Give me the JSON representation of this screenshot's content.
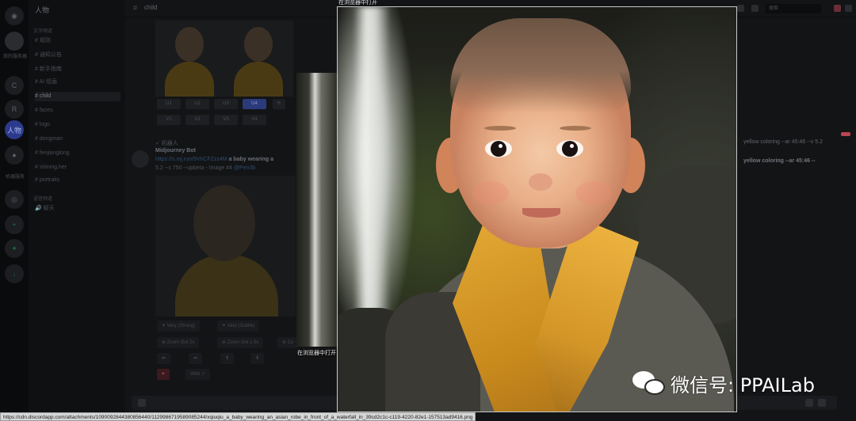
{
  "sidebar": {
    "header": "人物",
    "categories": [
      "文字频道",
      "语音频道"
    ],
    "channels": [
      "规则",
      "通知公告",
      "新手指南",
      "AI 绘画",
      "child",
      "faces",
      "logo",
      "dongman",
      "fenjianglong",
      "shining.her",
      "portraits"
    ],
    "voice": [
      "聊天"
    ],
    "server_labels": [
      "我的服务器",
      "人物",
      "机器服务"
    ]
  },
  "topbar": {
    "channel": "child",
    "search_placeholder": "搜索"
  },
  "grid_buttons": [
    "U1",
    "U2",
    "U3",
    "U4",
    "V1",
    "V2",
    "V3",
    "V4"
  ],
  "message": {
    "author": "Midjourney Bot",
    "badge": "✓ 机器人",
    "link": "https://s.mj.run/9VhCFZzz4M",
    "prompt": "a baby wearing an asian robe in front of a waterfall, yellow coloring --ar 45:46 -- 5.2 --s 750 --upbeta - Image #4",
    "prompt_short": "a baby wearing a",
    "line2": "5.2 --s 750 --upbeta - Image #4",
    "mention": "@Pen3b"
  },
  "right_prompt_1": "yellow coloring --ar 45:46 --v 5.2",
  "right_prompt_2": "yellow coloring --ar 45:46 --",
  "actions": {
    "vary_strong": "Vary (Strong)",
    "vary_subtle": "Vary (Subtle)",
    "zoom2": "Zoom Out 2x",
    "zoom15": "Zoom Out 1.5x",
    "custom": "Cu",
    "web": "Web"
  },
  "popup": {
    "open_in_browser_top": "在浏览器中打开",
    "open_in_browser_mid": "在浏览器中打开"
  },
  "status_url": "https://cdn.discordapp.com/attachments/1090092844380856440/1129986719589085244/xqiuqiu_a_baby_wearing_an_asian_robe_in_front_of_a_waterfall_in_39cd2c1c-c119-4220-82e1-157513ad9416.png",
  "watermark": {
    "text": "微信号: PPAILab"
  },
  "colors": {
    "accent": "#2a3a7a",
    "robe_yellow": "#e3a935",
    "notification": "#b94552"
  }
}
